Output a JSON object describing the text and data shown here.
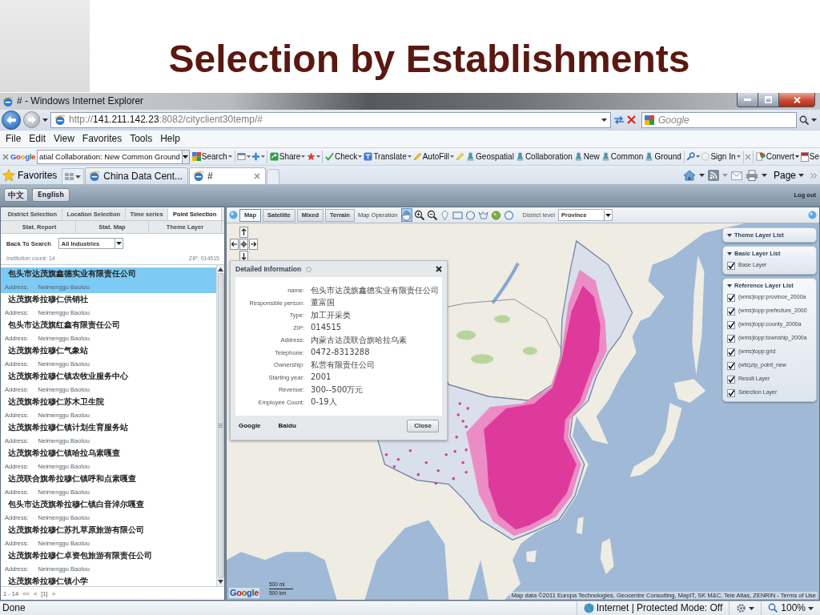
{
  "slide": {
    "title": "Selection by Establishments"
  },
  "window": {
    "title": "# - Windows Internet Explorer"
  },
  "address_bar": {
    "url": {
      "scheme": "http://",
      "host": "141.211.142.23",
      "path": ":8082/cityclient30temp/#"
    },
    "search_placeholder": "Google"
  },
  "menu": [
    "File",
    "Edit",
    "View",
    "Favorites",
    "Tools",
    "Help"
  ],
  "google_toolbar": {
    "logo": "Google",
    "query": "atial Collaboration: New Common Ground",
    "tools": [
      {
        "kind": "search",
        "label": "Search",
        "dropdown": true
      },
      {
        "kind": "popup",
        "dropdown": true
      },
      {
        "kind": "plus",
        "dropdown": true
      },
      {
        "kind": "share",
        "label": "Share",
        "dropdown": true
      },
      {
        "kind": "bookmark",
        "dropdown": true
      },
      {
        "kind": "check",
        "label": "Check",
        "dropdown": true
      },
      {
        "kind": "translate",
        "label": "Translate",
        "dropdown": true
      },
      {
        "kind": "autofill",
        "label": "AutoFill",
        "dropdown": true
      },
      {
        "kind": "highlight",
        "dropdown": false
      },
      {
        "kind": "term",
        "label": "Geospatial",
        "dropdown": false
      },
      {
        "kind": "term",
        "label": "Collaboration",
        "dropdown": false
      },
      {
        "kind": "term",
        "label": "New",
        "dropdown": false
      },
      {
        "kind": "term",
        "label": "Common",
        "dropdown": false
      },
      {
        "kind": "term",
        "label": "Ground",
        "dropdown": false
      },
      {
        "kind": "wrench",
        "dropdown": true
      },
      {
        "kind": "signin",
        "label": "Sign In",
        "dropdown": true
      }
    ],
    "convert": "Convert",
    "cut_item": "Se"
  },
  "favorites_bar": {
    "favorites": "Favorites",
    "tabs": [
      {
        "title": "China Data Cent...",
        "selected": false
      },
      {
        "title": "#",
        "selected": true
      }
    ],
    "page_menu": "Page"
  },
  "app": {
    "languages": [
      "中文",
      "English"
    ],
    "logout": "Log out"
  },
  "left_panel": {
    "tab_rows": [
      [
        {
          "label": "District Selection",
          "selected": false
        },
        {
          "label": "Location Selection",
          "selected": false
        },
        {
          "label": "Time series",
          "selected": false
        },
        {
          "label": "Point Selection",
          "selected": true
        }
      ],
      [
        {
          "label": "Stat. Report",
          "selected": false
        },
        {
          "label": "Stat. Map",
          "selected": false
        },
        {
          "label": "Theme Layer",
          "selected": false
        }
      ]
    ],
    "back_to_search": "Back To Search",
    "industry": "All Industries",
    "institution_count": "Institution count: 14",
    "zip": "ZIP: 014515",
    "results": [
      {
        "name": "包头市达茂旗鑫德实业有限责任公司",
        "address_label": "Address:",
        "address": "Neimenggu Baotou",
        "selected": true
      },
      {
        "name": "达茂旗希拉穆仁供销社",
        "address_label": "Address:",
        "address": "Neimenggu Baotou",
        "selected": false
      },
      {
        "name": "包头市达茂旗红鑫有限责任公司",
        "address_label": "Address:",
        "address": "Neimenggu Baotou",
        "selected": false
      },
      {
        "name": "达茂旗希拉穆仁气象站",
        "address_label": "Address:",
        "address": "Neimenggu Baotou",
        "selected": false
      },
      {
        "name": "达茂旗希拉穆仁镇农牧业服务中心",
        "address_label": "Address:",
        "address": "Neimenggu Baotou",
        "selected": false
      },
      {
        "name": "达茂旗希拉穆仁苏木卫生院",
        "address_label": "Address:",
        "address": "Neimenggu Baotou",
        "selected": false
      },
      {
        "name": "达茂旗希拉穆仁镇计划生育服务站",
        "address_label": "Address:",
        "address": "Neimenggu Baotou",
        "selected": false
      },
      {
        "name": "达茂旗希拉穆仁镇哈拉乌素嘎查",
        "address_label": "Address:",
        "address": "Neimenggu Baotou",
        "selected": false
      },
      {
        "name": "达茂联合旗希拉穆仁镇呼和点素嘎查",
        "address_label": "Address:",
        "address": "Neimenggu Baotou",
        "selected": false
      },
      {
        "name": "包头市达茂旗希拉穆仁镇白音淖尔嘎查",
        "address_label": "Address:",
        "address": "Neimenggu Baotou",
        "selected": false
      },
      {
        "name": "达茂旗希拉穆仁苏扎草原旅游有限公司",
        "address_label": "Address:",
        "address": "Neimenggu Baotou",
        "selected": false
      },
      {
        "name": "达茂旗希拉穆仁卓资包旅游有限责任公司",
        "address_label": "Address:",
        "address": "Neimenggu Baotou",
        "selected": false
      },
      {
        "name": "达茂旗希拉穆仁镇小学",
        "selected": false
      }
    ],
    "pagination": {
      "range": "1 - 14",
      "links": [
        "<<",
        "<",
        "[1]",
        ">"
      ]
    }
  },
  "map": {
    "types": [
      {
        "label": "Map",
        "selected": true
      },
      {
        "label": "Satellite",
        "selected": false
      },
      {
        "label": "Mixed",
        "selected": false
      },
      {
        "label": "Terrain",
        "selected": false
      }
    ],
    "operation_label": "Map Operation",
    "tools": [
      {
        "kind": "pan",
        "selected": true
      },
      {
        "kind": "zoom-in",
        "selected": false
      },
      {
        "kind": "zoom-out",
        "selected": false
      },
      {
        "kind": "marker",
        "selected": false
      },
      {
        "kind": "rectangle",
        "selected": false
      },
      {
        "kind": "circle",
        "selected": false
      },
      {
        "kind": "polygon",
        "selected": false
      },
      {
        "kind": "ball",
        "selected": false
      },
      {
        "kind": "ring",
        "selected": false
      }
    ],
    "district_label": "District level",
    "district": "Province",
    "detail": {
      "title": "Detailed Information",
      "fields": [
        {
          "label": "name:",
          "value": "包头市达茂旗鑫德实业有限责任公司"
        },
        {
          "label": "Responsible person:",
          "value": "董富国"
        },
        {
          "label": "Type:",
          "value": "加工开采类"
        },
        {
          "label": "ZIP:",
          "value": "014515"
        },
        {
          "label": "Address:",
          "value": "内蒙古达茂联合旗哈拉乌素"
        },
        {
          "label": "Telephone:",
          "value": "0472-8313288"
        },
        {
          "label": "Ownership:",
          "value": "私营有限责任公司"
        },
        {
          "label": "Starting year:",
          "value": "2001"
        },
        {
          "label": "Revenue:",
          "value": "300--500万元"
        },
        {
          "label": "Employee Count:",
          "value": "0-19人"
        }
      ],
      "links": [
        "Google",
        "Baidu"
      ],
      "close_button": "Close"
    },
    "layer_groups": [
      {
        "title": "Theme Layer List",
        "expanded": true
      },
      {
        "title": "Basic Layer List",
        "expanded": true,
        "layers": [
          {
            "label": "Base Layer",
            "checked": true
          }
        ]
      },
      {
        "title": "Reference Layer List",
        "expanded": true,
        "layers": [
          {
            "label": "(wms)topp:province_2000a",
            "checked": true
          },
          {
            "label": "(wms)topp:prefecture_2000",
            "checked": true
          },
          {
            "label": "(wms)topp:county_2000a",
            "checked": true
          },
          {
            "label": "(wms)topp:township_2000a",
            "checked": true
          },
          {
            "label": "(wms)topp:grid",
            "checked": true
          },
          {
            "label": "(wfs)zip_point_new",
            "checked": true
          },
          {
            "label": "Result Layer",
            "checked": true
          },
          {
            "label": "Selection Layer",
            "checked": true
          }
        ]
      }
    ],
    "scale": [
      "500 mi",
      "500 km"
    ],
    "logo": "Google",
    "attribution": "Map data ©2011 Europa Technologies, Geocentre Consulting, MapIT, SK M&C, Tele Atlas, ZENRIN - ",
    "terms": "Terms of Use"
  },
  "status_bar": {
    "text": "Done",
    "zone": "Internet | Protected Mode: Off",
    "zoom": "100%"
  }
}
